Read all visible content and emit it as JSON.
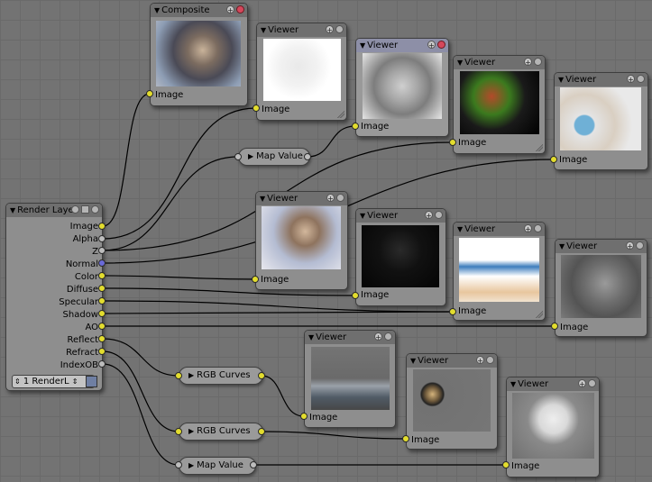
{
  "render_layer": {
    "title": "Render Laye",
    "outputs": [
      "Image",
      "Alpha",
      "Z",
      "Normal",
      "Color",
      "Diffuse",
      "Specular",
      "Shadow",
      "AO",
      "Reflect",
      "Refract",
      "IndexOB"
    ],
    "layer_select": "1 RenderL"
  },
  "composite": {
    "title": "Composite",
    "input": "Image"
  },
  "viewers": [
    {
      "title": "Viewer",
      "input": "Image"
    },
    {
      "title": "Viewer",
      "input": "Image"
    },
    {
      "title": "Viewer",
      "input": "Image"
    },
    {
      "title": "Viewer",
      "input": "Image"
    },
    {
      "title": "Viewer",
      "input": "Image"
    },
    {
      "title": "Viewer",
      "input": "Image"
    },
    {
      "title": "Viewer",
      "input": "Image"
    },
    {
      "title": "Viewer",
      "input": "Image"
    },
    {
      "title": "Viewer",
      "input": "Image"
    },
    {
      "title": "Viewer",
      "input": "Image"
    },
    {
      "title": "Viewer",
      "input": "Image"
    }
  ],
  "map_value_1": "Map Value",
  "map_value_2": "Map Value",
  "rgb_curves_1": "RGB Curves",
  "rgb_curves_2": "RGB Curves",
  "colors": {
    "background": "#737373",
    "node_body": "#8e8e8e",
    "header_selected": "#8d8fa7",
    "socket_color": "#e3dd2e",
    "socket_value": "#bdbdbd",
    "socket_vector": "#6a6ad8",
    "wire": "#000000"
  }
}
